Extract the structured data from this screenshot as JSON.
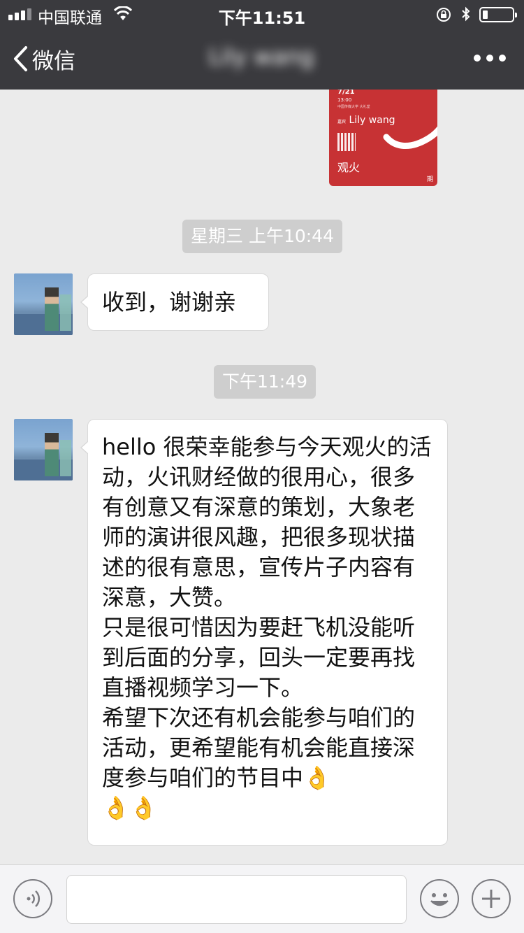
{
  "status_bar": {
    "carrier": "中国联通",
    "time": "下午11:51",
    "battery_level": 0.18
  },
  "nav": {
    "back_label": "微信",
    "chat_title": "Lily wang"
  },
  "poster": {
    "date": "7/21",
    "time": "13:00",
    "venue": "中国传媒大学 大礼堂",
    "guest_prefix": "嘉宾",
    "guest_name": "Lily wang",
    "brand": "观火",
    "issue_suffix": "期",
    "colors": {
      "background": "#c73234"
    }
  },
  "timestamps": [
    "星期三 上午10:44",
    "下午11:49"
  ],
  "messages": [
    {
      "text": "收到，谢谢亲"
    },
    {
      "text": "hello 很荣幸能参与今天观火的活动，火讯财经做的很用心，很多有创意又有深意的策划，大象老师的演讲很风趣，把很多现状描述的很有意思，宣传片子内容有深意，大赞。\n只是很可惜因为要赶飞机没能听到后面的分享，回头一定要再找直播视频学习一下。\n希望下次还有机会能参与咱们的活动，更希望能有机会能直接深度参与咱们的节目中👌\n👌👌"
    }
  ],
  "input_bar": {
    "voice_icon": "voice-icon",
    "emoji_icon": "emoji-icon",
    "plus_icon": "plus-icon",
    "message_value": ""
  },
  "colors": {
    "nav_background": "#3a3a3e",
    "chat_background": "#ebebeb",
    "timestamp_pill": "#cecece",
    "bubble": "#ffffff"
  }
}
